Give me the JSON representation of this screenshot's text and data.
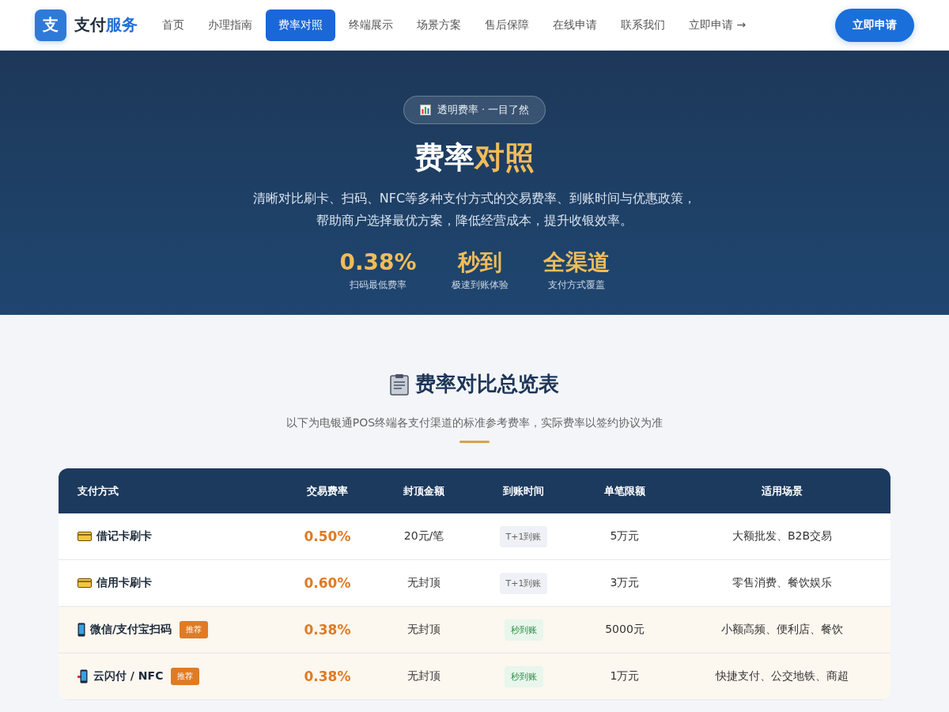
{
  "header": {
    "logo_mark": "支",
    "logo_text": "支付",
    "logo_accent": "服务",
    "nav": [
      {
        "label": "首页",
        "selected": false
      },
      {
        "label": "办理指南",
        "selected": false
      },
      {
        "label": "费率对照",
        "selected": true
      },
      {
        "label": "终端展示",
        "selected": false
      },
      {
        "label": "场景方案",
        "selected": false
      },
      {
        "label": "售后保障",
        "selected": false
      },
      {
        "label": "在线申请",
        "selected": false
      },
      {
        "label": "联系我们",
        "selected": false
      },
      {
        "label": "立即申请 →",
        "selected": false
      }
    ],
    "cta": "立即申请"
  },
  "hero": {
    "badge": "透明费率 · 一目了然",
    "title": "费率",
    "title_accent": "对照",
    "description": "清晰对比刷卡、扫码、NFC等多种支付方式的交易费率、到账时间与优惠政策，帮助商户选择最优方案，降低经营成本，提升收银效率。",
    "stats": [
      {
        "value": "0.38%",
        "label": "扫码最低费率"
      },
      {
        "value": "秒到",
        "label": "极速到账体验"
      },
      {
        "value": "全渠道",
        "label": "支付方式覆盖"
      }
    ]
  },
  "section": {
    "title": "费率对比总览表",
    "subtitle": "以下为电银通POS终端各支付渠道的标准参考费率，实际费率以签约协议为准"
  },
  "table": {
    "columns": [
      "支付方式",
      "交易费率",
      "封顶金额",
      "到账时间",
      "单笔限额",
      "适用场景"
    ],
    "rows": [
      {
        "kind": "card",
        "method": "借记卡刷卡",
        "badge": null,
        "featured": false,
        "rate": "0.50%",
        "cap": "20元/笔",
        "arrival": {
          "kind": "t1",
          "text": "T+1到账"
        },
        "limit": "5万元",
        "scene": "大额批发、B2B交易"
      },
      {
        "kind": "card",
        "method": "信用卡刷卡",
        "badge": null,
        "featured": false,
        "rate": "0.60%",
        "cap": "无封顶",
        "arrival": {
          "kind": "t1",
          "text": "T+1到账"
        },
        "limit": "3万元",
        "scene": "零售消费、餐饮娱乐"
      },
      {
        "kind": "phone",
        "method": "微信/支付宝扫码",
        "badge": "推荐",
        "featured": true,
        "rate": "0.38%",
        "cap": "无封顶",
        "arrival": {
          "kind": "instant",
          "text": "秒到账"
        },
        "limit": "5000元",
        "scene": "小额高频、便利店、餐饮"
      },
      {
        "kind": "nfc",
        "method": "云闪付 / NFC",
        "badge": "推荐",
        "featured": true,
        "rate": "0.38%",
        "cap": "无封顶",
        "arrival": {
          "kind": "instant",
          "text": "秒到账"
        },
        "limit": "1万元",
        "scene": "快捷支付、公交地铁、商超"
      }
    ]
  }
}
